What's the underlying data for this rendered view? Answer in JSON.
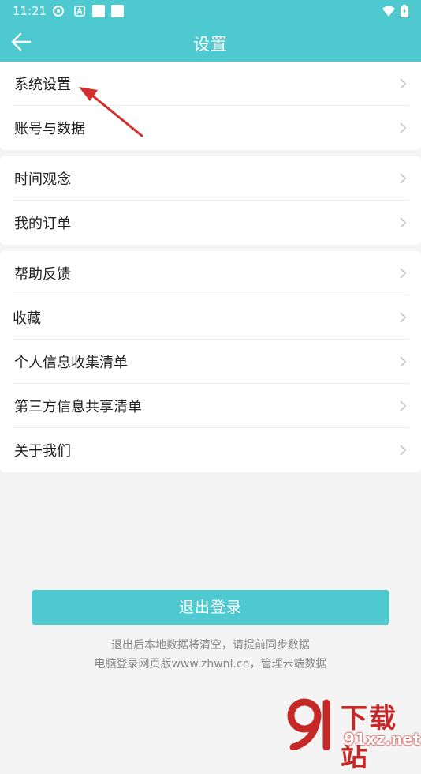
{
  "status_bar": {
    "time": "11:21"
  },
  "nav": {
    "title": "设置"
  },
  "groups": [
    {
      "items": [
        {
          "label": "系统设置"
        },
        {
          "label": "账号与数据"
        }
      ]
    },
    {
      "items": [
        {
          "label": "时间观念"
        },
        {
          "label": "我的订单"
        }
      ]
    },
    {
      "items": [
        {
          "label": "帮助反馈"
        },
        {
          "label": "收藏"
        },
        {
          "label": "个人信息收集清单"
        },
        {
          "label": "第三方信息共享清单"
        },
        {
          "label": "关于我们"
        }
      ]
    }
  ],
  "logout": {
    "label": "退出登录",
    "note1": "退出后本地数据将清空，请提前同步数据",
    "note2": "电脑登录网页版www.zhwnl.cn，管理云端数据"
  },
  "watermark": {
    "brand": "下载站",
    "domain": "91xz.net"
  },
  "colors": {
    "accent": "#4ec9d0",
    "annotation_arrow": "#d32f2f"
  },
  "icons": [
    "back-arrow-icon",
    "chevron-right-icon",
    "wifi-icon",
    "battery-icon"
  ]
}
